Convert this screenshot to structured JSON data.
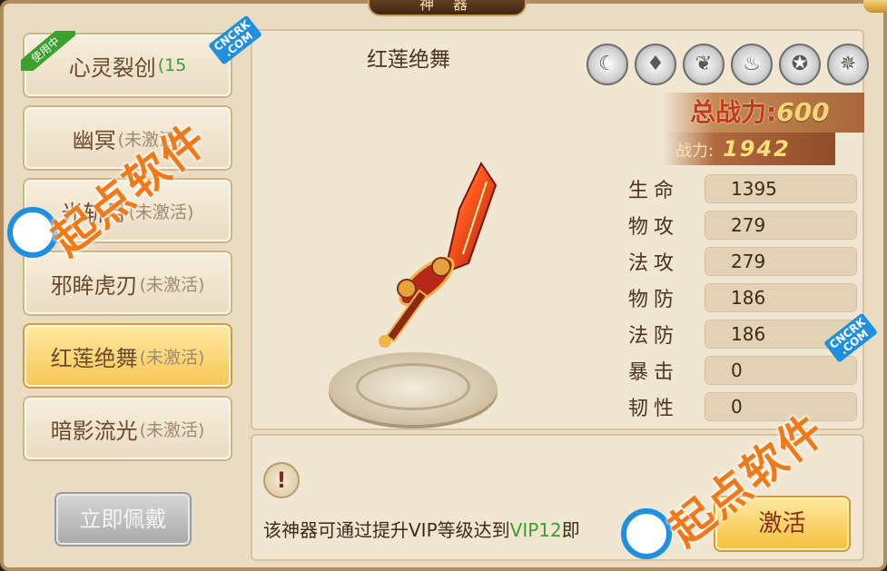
{
  "window": {
    "title": "神 器"
  },
  "artifacts": [
    {
      "name": "心灵裂创",
      "status": "(15",
      "in_use": true,
      "badge": "使用中"
    },
    {
      "name": "幽冥",
      "status": "(未激活)",
      "in_use": false
    },
    {
      "name": "光斩月",
      "status": "(未激活)",
      "in_use": false
    },
    {
      "name": "邪眸虎刃",
      "status": "(未激活)",
      "in_use": false
    },
    {
      "name": "红莲绝舞",
      "status": "(未激活)",
      "in_use": false,
      "selected": true
    },
    {
      "name": "暗影流光",
      "status": "(未激活)",
      "in_use": false
    }
  ],
  "buttons": {
    "wear": "立即佩戴",
    "activate": "激活"
  },
  "detail": {
    "name": "红莲绝舞",
    "total_power_label": "总战力:",
    "total_power": "600",
    "power_label": "战力:",
    "power": "1942",
    "stats": [
      {
        "label": "生命",
        "value": "1395"
      },
      {
        "label": "物攻",
        "value": "279"
      },
      {
        "label": "法攻",
        "value": "279"
      },
      {
        "label": "物防",
        "value": "186"
      },
      {
        "label": "法防",
        "value": "186"
      },
      {
        "label": "暴击",
        "value": "0"
      },
      {
        "label": "韧性",
        "value": "0"
      }
    ],
    "hint_prefix": "该神器可通过提升VIP等级达到",
    "hint_vip": "VIP12",
    "hint_suffix": "即"
  },
  "category_icons": [
    "moon-icon",
    "blade-icon",
    "wing-icon",
    "flame-icon",
    "beast-mask-icon",
    "demon-icon"
  ],
  "watermark": {
    "text": "起点软件",
    "badge_top": "CNCRK",
    "badge_bottom": ".COM"
  },
  "colors": {
    "accent_orange": "#f07a1a",
    "vip_green": "#3aa12c",
    "selected_gold": "#f6c653"
  }
}
